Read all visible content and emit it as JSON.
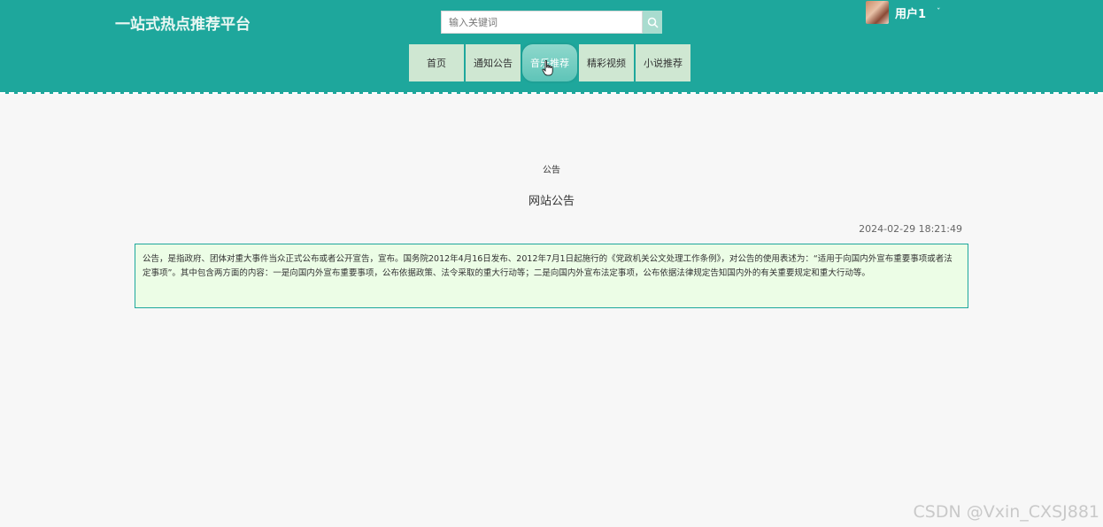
{
  "header": {
    "site_title": "一站式热点推荐平台",
    "search": {
      "placeholder": "输入关键词",
      "value": "",
      "icon": "search-icon"
    },
    "user": {
      "name": "用户1",
      "caret": "ˇ"
    }
  },
  "nav": {
    "items": [
      {
        "label": "首页"
      },
      {
        "label": "通知公告"
      },
      {
        "label": "音乐推荐",
        "active": true
      },
      {
        "label": "精彩视频"
      },
      {
        "label": "小说推荐"
      }
    ]
  },
  "notice": {
    "category": "公告",
    "title": "网站公告",
    "time": "2024-02-29 18:21:49",
    "body": "公告，是指政府、团体对重大事件当众正式公布或者公开宣告，宣布。国务院2012年4月16日发布、2012年7月1日起施行的《党政机关公文处理工作条例》，对公告的使用表述为：“适用于向国内外宣布重要事项或者法定事项”。其中包含两方面的内容：一是向国内外宣布重要事项，公布依据政策、法令采取的重大行动等；二是向国内外宣布法定事项，公布依据法律规定告知国内外的有关重要规定和重大行动等。"
  },
  "watermark": "CSDN @Vxin_CXSJ881",
  "colors": {
    "header_bg": "#1ea79c",
    "nav_bg": "#cfe7d2",
    "content_bg": "#ecfde6"
  }
}
